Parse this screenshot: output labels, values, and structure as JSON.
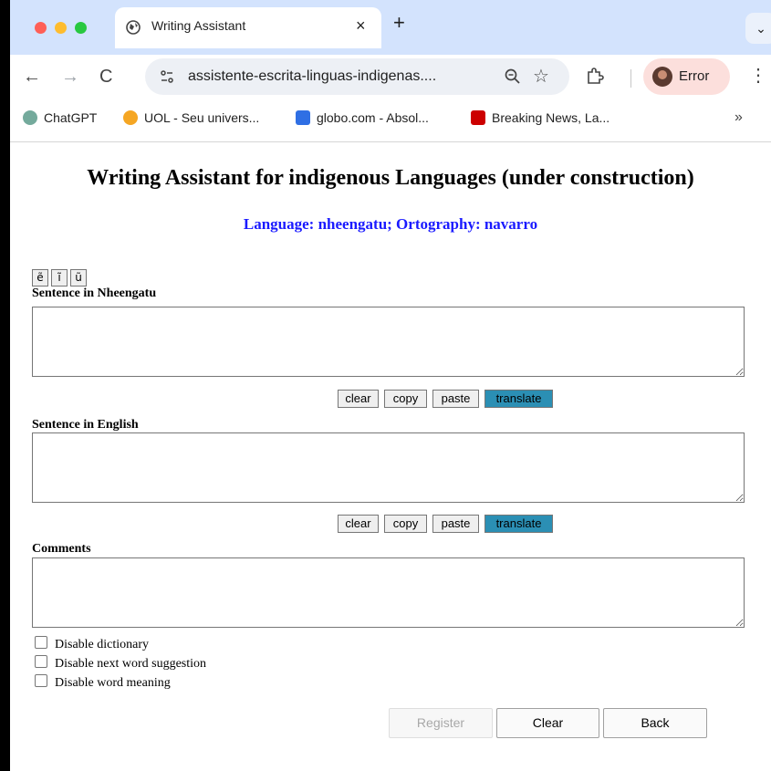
{
  "browser": {
    "tab_title": "Writing Assistant",
    "tab_close": "×",
    "new_tab": "+",
    "tab_search": "⌄",
    "url": "assistente-escrita-linguas-indigenas....",
    "profile_label": "Error",
    "nav": {
      "back": "←",
      "forward": "→",
      "reload": "C"
    },
    "menu": "⋮",
    "bookmarks": [
      {
        "label": "ChatGPT",
        "icon": "chatgpt-icon",
        "color": "#74aa9c"
      },
      {
        "label": "UOL - Seu univers...",
        "icon": "uol-icon",
        "color": "#f5a623"
      },
      {
        "label": "globo.com - Absol...",
        "icon": "globo-icon",
        "color": "#2f6fe4"
      },
      {
        "label": "Breaking News, La...",
        "icon": "cnn-icon",
        "color": "#cc0000"
      }
    ],
    "bookmarks_more": "»"
  },
  "page": {
    "title": "Writing Assistant for indigenous Languages (under construction)",
    "subtitle": "Language: nheengatu; Ortography: navarro",
    "special_chars": [
      "ẽ",
      "ĩ",
      "ũ"
    ],
    "section1": {
      "label": "Sentence in Nheengatu",
      "value": "",
      "buttons": {
        "clear": "clear",
        "copy": "copy",
        "paste": "paste",
        "translate": "translate"
      }
    },
    "section2": {
      "label": "Sentence in English",
      "value": "",
      "buttons": {
        "clear": "clear",
        "copy": "copy",
        "paste": "paste",
        "translate": "translate"
      }
    },
    "comments": {
      "label": "Comments",
      "value": ""
    },
    "checkboxes": [
      {
        "label": "Disable dictionary",
        "checked": false
      },
      {
        "label": "Disable next word suggestion",
        "checked": false
      },
      {
        "label": "Disable word meaning",
        "checked": false
      }
    ],
    "actions": {
      "register": "Register",
      "clear": "Clear",
      "back": "Back"
    }
  },
  "colors": {
    "accent": "#2b8fb4",
    "subtitle": "#1a1aff",
    "tabstrip": "#d3e3fd",
    "profile_bg": "#fcdfdc"
  }
}
